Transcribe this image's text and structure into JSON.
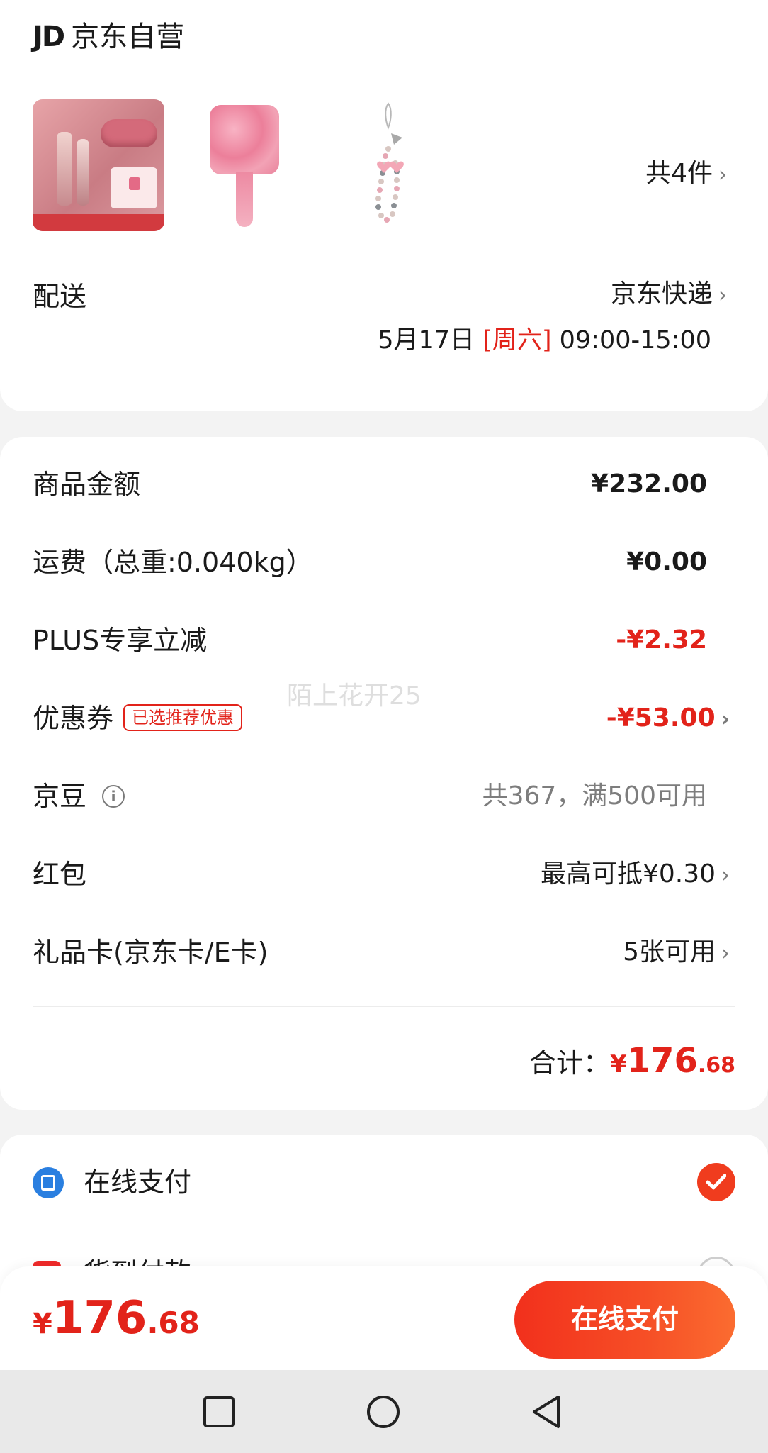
{
  "shop": {
    "logo": "JD",
    "name": "京东自营",
    "item_count": "共4件"
  },
  "delivery": {
    "label": "配送",
    "method": "京东快递",
    "date": "5月17日",
    "weekday": "[周六]",
    "time_range": "09:00-15:00"
  },
  "fees": {
    "goods_amount": {
      "label": "商品金额",
      "value": "¥232.00"
    },
    "shipping": {
      "label": "运费（总重:0.040kg）",
      "value": "¥0.00"
    },
    "plus_discount": {
      "label": "PLUS专享立减",
      "value": "-¥2.32"
    },
    "coupon": {
      "label": "优惠券",
      "tag": "已选推荐优惠",
      "value": "-¥53.00"
    },
    "jingdou": {
      "label": "京豆",
      "value": "共367，满500可用"
    },
    "red_packet": {
      "label": "红包",
      "value": "最高可抵¥0.30"
    },
    "gift_card": {
      "label": "礼品卡(京东卡/E卡)",
      "value": "5张可用"
    },
    "total_label": "合计：",
    "total_currency": "¥",
    "total_int": "176",
    "total_dec": ".68"
  },
  "watermark": "陌上花开25",
  "payment": {
    "online_label": "在线支付",
    "cod_label": "货到付款"
  },
  "bottom_bar": {
    "currency": "¥",
    "amount_int": "176",
    "amount_dec": ".68",
    "pay_button": "在线支付"
  },
  "colors": {
    "accent_red": "#e2231a",
    "button_orange": "#f64f26",
    "pay_icon_blue": "#2a7fe0"
  }
}
